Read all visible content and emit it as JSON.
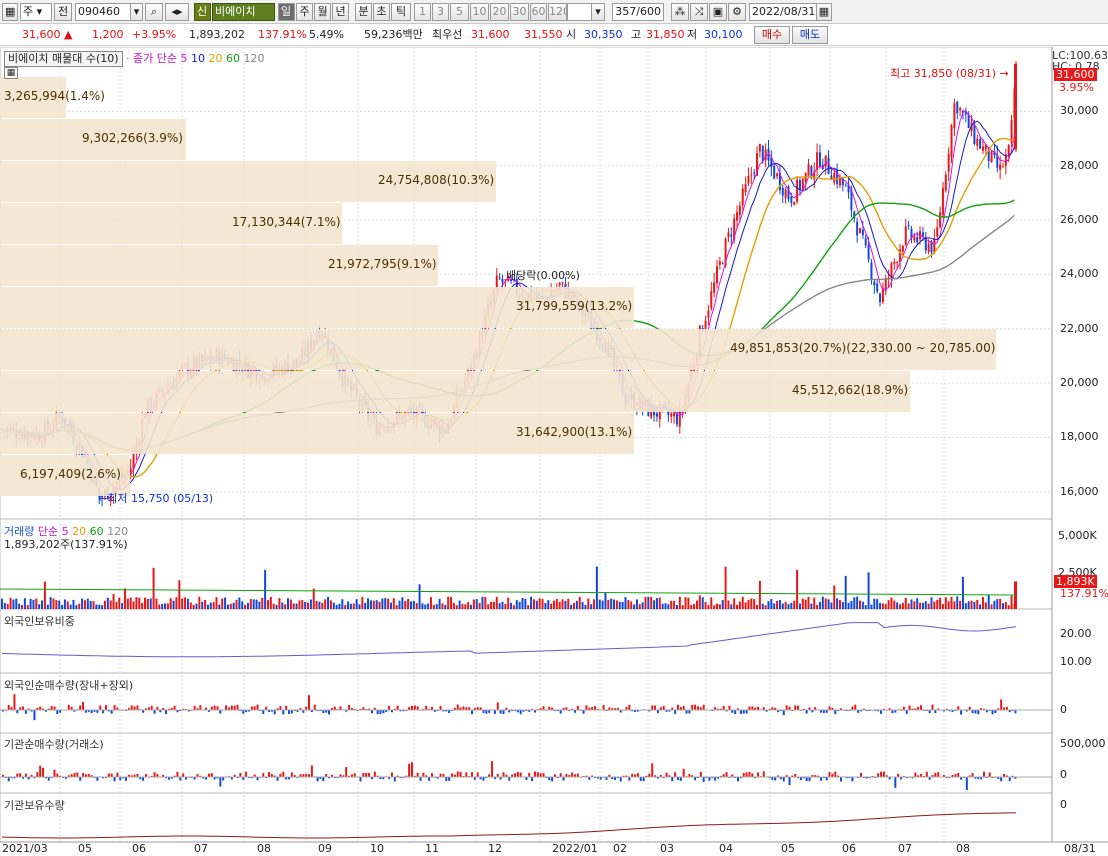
{
  "toolbar": {
    "market_selector": "주",
    "exchange_label": "전",
    "stock_code": "090460",
    "credit_badge": "신",
    "stock_name": "비에이치",
    "period_daily": "일",
    "period_weekly": "주",
    "period_monthly": "월",
    "period_yearly": "년",
    "period_minute": "분",
    "period_second": "초",
    "period_tick": "틱",
    "intervals": [
      "1",
      "3",
      "5",
      "10",
      "20",
      "30",
      "60",
      "120"
    ],
    "count_display": "357/600",
    "date": "2022/08/31"
  },
  "quote": {
    "price": "31,600",
    "change": "1,200",
    "change_pct": "+3.95%",
    "volume": "1,893,202",
    "volume_ratio": "137.91%",
    "turnover": "5.49%",
    "amount": "59,236백만",
    "best_bid_label": "최우선",
    "best_ask": "31,600",
    "best_bid": "31,550",
    "open_label": "시",
    "open": "30,350",
    "high_label": "고",
    "high": "31,850",
    "low_label": "저",
    "low": "30,100",
    "buy_button": "매수",
    "sell_button": "매도"
  },
  "main_panel": {
    "title": "비에이치 매물대 수(10)",
    "ma_label": "종가 단순",
    "ma_periods": [
      "5",
      "10",
      "20",
      "60",
      "120"
    ],
    "ma_colors": [
      "#e010e0",
      "#1818c8",
      "#e0a000",
      "#10a010",
      "#888888"
    ],
    "lc_label": "LC:100.63",
    "hc_label": "HC: 0.78",
    "current_tag": "31,600",
    "current_pct": "3.95%",
    "high_note": "최고 31,850 (08/31)",
    "low_note": "최저 15,750 (05/13)",
    "dividend_note": "배당락(0.00%)",
    "y_ticks": [
      "30,000",
      "28,000",
      "26,000",
      "24,000",
      "22,000",
      "20,000",
      "18,000",
      "16,000"
    ],
    "volume_profile": [
      {
        "label": "3,265,994(1.4%)",
        "price_mid": 31000
      },
      {
        "label": "9,302,266(3.9%)",
        "price_mid": 29800
      },
      {
        "label": "24,754,808(10.3%)",
        "price_mid": 28600
      },
      {
        "label": "17,130,344(7.1%)",
        "price_mid": 27400
      },
      {
        "label": "21,972,795(9.1%)",
        "price_mid": 26200
      },
      {
        "label": "31,799,559(13.2%)",
        "price_mid": 25000
      },
      {
        "label": "49,851,853(20.7%)(22,330.00 ~ 20,785.00)",
        "price_mid": 23800
      },
      {
        "label": "45,512,662(18.9%)",
        "price_mid": 22600
      },
      {
        "label": "31,642,900(13.1%)",
        "price_mid": 21400
      },
      {
        "label": "6,197,409(2.6%)",
        "price_mid": 20200
      }
    ]
  },
  "volume_panel": {
    "title": "거래량",
    "ma_label": "단순",
    "ma_periods": [
      "5",
      "20",
      "60",
      "120"
    ],
    "value_line": "1,893,202주(137.91%)",
    "y_ticks": [
      "5,000K",
      "2,500K"
    ],
    "current_tag": "1,893K",
    "current_pct": "137.91%"
  },
  "foreign_ratio_panel": {
    "title": "외국인보유비중",
    "y_ticks": [
      "20.00",
      "10.00"
    ]
  },
  "foreign_net_panel": {
    "title": "외국인순매수량(장내+장외)",
    "y_ticks": [
      "0"
    ]
  },
  "inst_net_panel": {
    "title": "기관순매수량(거래소)",
    "y_ticks": [
      "500,000",
      "0"
    ]
  },
  "inst_hold_panel": {
    "title": "기관보유수량",
    "y_ticks": [
      "0"
    ]
  },
  "x_axis": {
    "labels": [
      "2021/03",
      "05",
      "06",
      "07",
      "08",
      "09",
      "10",
      "11",
      "12",
      "2022/01",
      "02",
      "03",
      "04",
      "05",
      "06",
      "07",
      "08"
    ],
    "end_label": "08/31"
  },
  "colors": {
    "up": "#e81818",
    "down": "#1048d8",
    "profile": "#f3e5cf",
    "grid": "#d9dde4"
  },
  "chart_data": {
    "type": "candlestick",
    "title": "비에이치 (090460) daily",
    "ylim": [
      15000,
      32000
    ],
    "key_prices": {
      "start_2021_03": 18300,
      "low_2021_05": 15750,
      "peak_2021_09": 22100,
      "peak_2021_12": 23800,
      "dip_2022_03": 18700,
      "peak_2022_05": 28600,
      "dip_2022_06": 23100,
      "peak_2022_08": 30400,
      "last_close": 31600,
      "last_high": 31850
    }
  }
}
